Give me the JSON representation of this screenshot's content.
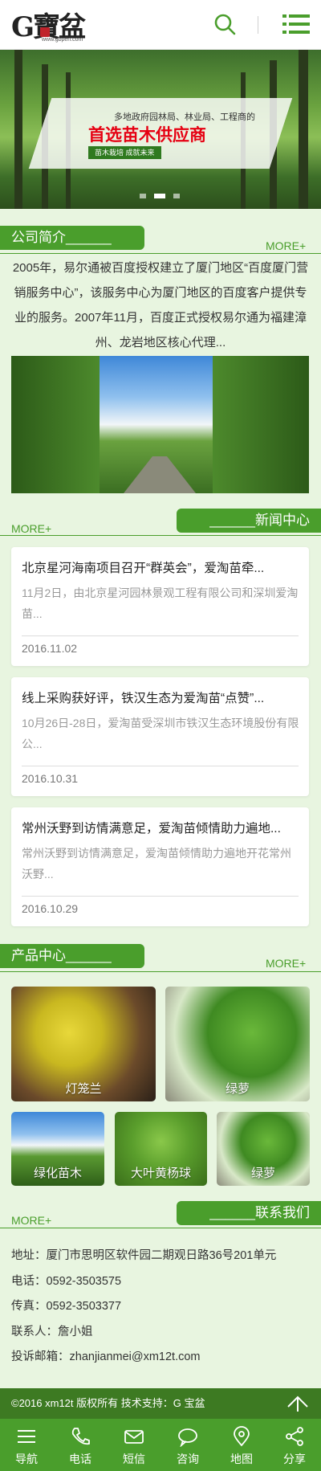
{
  "header": {
    "logo_main": "G寶盆",
    "logo_url": "www.gbpen.com",
    "search_icon": "search-icon",
    "menu_icon": "menu-icon"
  },
  "banner": {
    "line1": "多地政府园林局、林业局、工程商的",
    "title": "首选苗木供应商",
    "tag": "苗木栽培 成就未来"
  },
  "intro": {
    "heading": "公司简介______",
    "more": "MORE+",
    "text": "2005年，易尔通被百度授权建立了厦门地区“百度厦门营销服务中心”，该服务中心为厦门地区的百度客户提供专业的服务。2007年11月，百度正式授权易尔通为福建漳州、龙岩地区核心代理..."
  },
  "news": {
    "heading": "______新闻中心",
    "more": "MORE+",
    "items": [
      {
        "title": "北京星河海南项目召开“群英会”，爱淘苗牵...",
        "desc": "11月2日，由北京星河园林景观工程有限公司和深圳爱淘苗...",
        "date": "2016.11.02"
      },
      {
        "title": "线上采购获好评，铁汉生态为爱淘苗“点赞”...",
        "desc": "10月26日-28日，爱淘苗受深圳市铁汉生态环境股份有限公...",
        "date": "2016.10.31"
      },
      {
        "title": "常州沃野到访情满意足，爱淘苗倾情助力遍地...",
        "desc": "常州沃野到访情满意足，爱淘苗倾情助力遍地开花常州沃野...",
        "date": "2016.10.29"
      }
    ]
  },
  "products": {
    "heading": "产品中心______",
    "more": "MORE+",
    "items": [
      {
        "label": "灯笼兰"
      },
      {
        "label": "绿萝"
      },
      {
        "label": "绿化苗木"
      },
      {
        "label": "大叶黄杨球"
      },
      {
        "label": "绿萝"
      }
    ]
  },
  "contact": {
    "heading": "______联系我们",
    "more": "MORE+",
    "address": "地址：厦门市思明区软件园二期观日路36号201单元",
    "phone": "电话：0592-3503575",
    "fax": "传真：0592-3503377",
    "person": "联系人：詹小姐",
    "email": "投诉邮箱：zhanjianmei@xm12t.com"
  },
  "footer": {
    "copyright": "©2016 xm12t 版权所有  技术支持：G 宝盆"
  },
  "bottom_nav": [
    {
      "label": "导航",
      "icon": "menu-icon"
    },
    {
      "label": "电话",
      "icon": "phone-icon"
    },
    {
      "label": "短信",
      "icon": "mail-icon"
    },
    {
      "label": "咨询",
      "icon": "chat-icon"
    },
    {
      "label": "地图",
      "icon": "map-pin-icon"
    },
    {
      "label": "分享",
      "icon": "share-icon"
    }
  ]
}
